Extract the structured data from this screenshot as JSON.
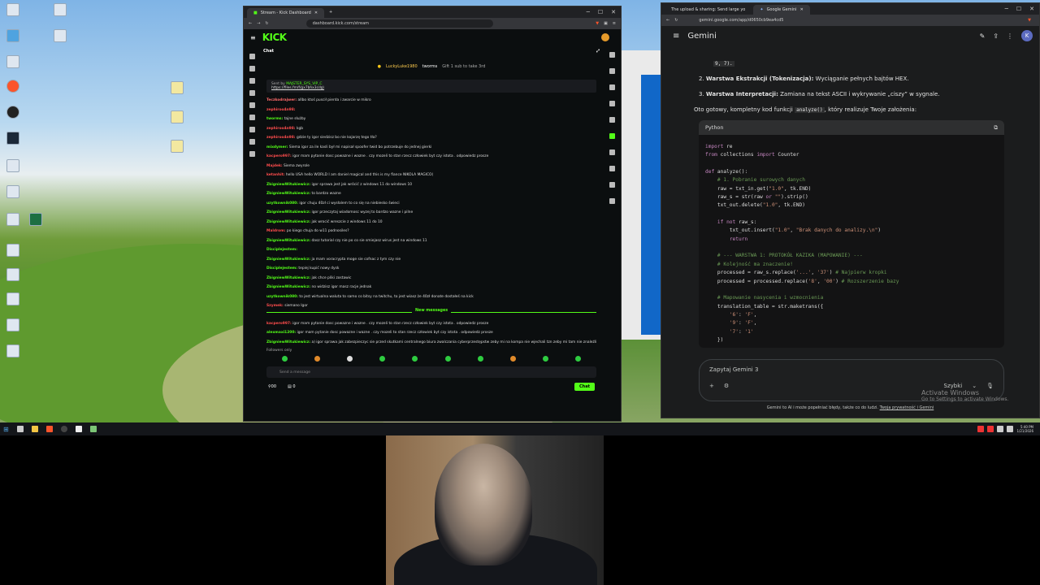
{
  "desktop": {
    "icons": [
      {
        "label": "Nowy Tekst Dokument"
      },
      {
        "label": "This PC"
      },
      {
        "label": "Recycle Bin"
      },
      {
        "label": "Brave"
      },
      {
        "label": "OBS Studio"
      },
      {
        "label": "Nowy Tekst Dokument"
      }
    ]
  },
  "kick_window": {
    "tab_title": "Stream - Kick Dashboard",
    "url": "dashboard.kick.com/stream",
    "logo": "KICK",
    "chat_title": "Chat",
    "subs": {
      "user1": "LuckyLuke1980",
      "user2": "tworms",
      "gift": "Gift 1 sub to take 3rd"
    },
    "pinned": {
      "sent_by": "Sent by",
      "author": "MAJSTER_SYS_VIP_C",
      "link": "https://files.fm/f/gx7bhx3cdg\\"
    },
    "messages": [
      {
        "user": "Teczkodrajwer:",
        "text": "allbo ktoś puscił pierda i zwarcie w mikro",
        "color": "#ff6b6b"
      },
      {
        "user": "zephiroo4n98:",
        "text": "",
        "color": "#ff4d4d"
      },
      {
        "user": "tworms:",
        "text": "tajne służby",
        "color": "#53fc18"
      },
      {
        "user": "zephiroo4n98:",
        "text": "kgb",
        "color": "#ff4d4d"
      },
      {
        "user": "zephiroo4n98:",
        "text": "gdzie ty igor siedzisz bo nie kojarzę tego tła?",
        "color": "#ff4d4d"
      },
      {
        "user": "mixdymer:",
        "text": "Siema igor za ile kasli był mi napisał spoofer twid bo potrzebuje do jednej gierki",
        "color": "#53fc18"
      },
      {
        "user": "kacpero997:",
        "text": "igor mam pytanie dosc powazne i wazne . czy mozeli to stan rzecz człowiek byt czy istota . odpowiedz prosze",
        "color": "#ff4d4d"
      },
      {
        "user": "Majdek:",
        "text": "Siema zwyrole",
        "color": "#ff4d4d"
      },
      {
        "user": "ketanhit:",
        "text": "hello USA hello WORLD I am daniel magical and this is my fiance NIKOLA MAGICO(",
        "color": "#ff4d4d"
      },
      {
        "user": "ZbigniewWitukiewicz:",
        "text": "igor sprawa jest jak wrócić z windows 11 do windows 10",
        "color": "#53fc18"
      },
      {
        "user": "ZbigniewWitukiewicz:",
        "text": "to bardzo wazne",
        "color": "#53fc18"
      },
      {
        "user": "uzytkownik080:",
        "text": "igor chuju 40zł ci wysłalem to co się na niebiesko świeci",
        "color": "#53fc18"
      },
      {
        "user": "ZbigniewWitukiewicz:",
        "text": "igor przeczytaj wiadomosc wyzej to bardzo wazne i pilne",
        "color": "#53fc18"
      },
      {
        "user": "ZbigniewWitukiewicz:",
        "text": "jak wrocić wreszcie z windows 11 do 10",
        "color": "#53fc18"
      },
      {
        "user": "Maldrom:",
        "text": "po kiego chuja do w11 podnosiles?",
        "color": "#ff4d4d"
      },
      {
        "user": "ZbigniewWitukiewicz:",
        "text": "dasz tutorial czy nie po co sie smiejasz wirus jest na windows 11",
        "color": "#53fc18"
      },
      {
        "user": "Disciplejestem:",
        "text": "",
        "color": "#53fc18"
      },
      {
        "user": "ZbigniewWitukiewicz:",
        "text": "ja mam voracrypta moge sie cofnac z tym czy nie",
        "color": "#53fc18"
      },
      {
        "user": "Disciplejestem:",
        "text": "tepiej kupić nowy dysk",
        "color": "#53fc18"
      },
      {
        "user": "ZbigniewWitukiewicz:",
        "text": "jak chce pliki zostawic",
        "color": "#53fc18"
      },
      {
        "user": "ZbigniewWitukiewicz:",
        "text": "no widzisz igor masz racje jednak",
        "color": "#53fc18"
      },
      {
        "user": "uzytkownik080:",
        "text": "to jest wirtualna waluta to samo co bitsy na twitchu, to jest wiasz że 40zł donate dostałeś na kick",
        "color": "#53fc18"
      },
      {
        "user": "Szymek:",
        "text": "siemano Igor",
        "color": "#ff4d4d"
      }
    ],
    "new_messages_label": "New messages",
    "new_messages": [
      {
        "user": "kacpero997:",
        "text": "igor mam pytanie dosc powazne i wazne . czy mozeli to stan rzecz człowiek byt czy istota . odpowiedz prosze",
        "color": "#ff4d4d"
      },
      {
        "user": "alexmaxi1200:",
        "text": "igor mam pytanie dosc powazne i wazne . czy mozeli to stan rzecz człowiek byt czy istota . odpowiedz prosze",
        "color": "#53fc18"
      },
      {
        "user": "ZbigniewWitukiewicz:",
        "text": "a) igor sprawa jak zabezpieczyc sie przed skutkami centralnego biura zwalczania cyberprzestępstw zeby mi na kompa nie wjechali tzn zeby mi tam nie znaleźli nic",
        "color": "#53fc18"
      }
    ],
    "followers_only": "Followers only",
    "send_placeholder": "Send a message",
    "counter_viewers": "00",
    "counter_other": "0",
    "chat_button": "Chat"
  },
  "gemini_window": {
    "tab_inactive": "The upload & sharing: Send large yo",
    "tab_active": "Google Gemini",
    "url": "gemini.google.com/app/d0650cb9ea4cd5",
    "app_name": "Gemini",
    "avatar_letter": "K",
    "list_tail": "9, 7).",
    "point2_num": "2.",
    "point2_bold": "Warstwa Ekstrakcji (Tokenizacja):",
    "point2_text": "Wyciąganie pełnych bajtów HEX.",
    "point3_num": "3.",
    "point3_bold": "Warstwa Interpretacji:",
    "point3_text": "Zamiana na tekst ASCII i wykrywanie „ciszy” w sygnale.",
    "intro_a": "Oto gotowy, kompletny kod funkcji",
    "intro_code": "analyze()",
    "intro_b": ", który realizuje Twoje założenia:",
    "code_lang": "Python",
    "input_placeholder": "Zapytaj Gemini 3",
    "mode_label": "Szybki",
    "footer_text": "Gemini to AI i może popełniać błędy, także co do ludzi.",
    "footer_link": "Twoja prywatność i Gemini",
    "activate_1": "Activate Windows",
    "activate_2": "Go to Settings to activate Windows."
  },
  "taskbar": {
    "time": "5:40 PM",
    "date": "1/21/2026"
  }
}
